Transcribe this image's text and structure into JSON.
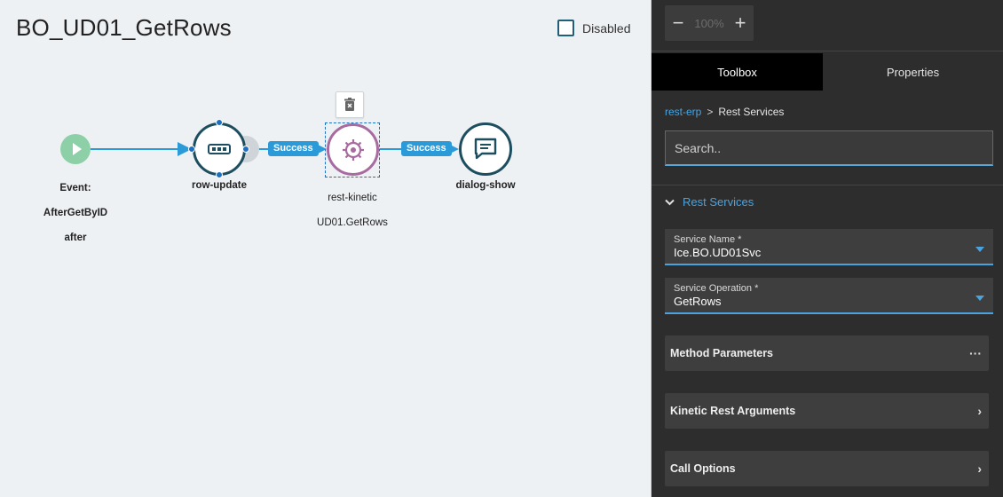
{
  "canvas": {
    "title": "BO_UD01_GetRows",
    "disabled_label": "Disabled",
    "nodes": {
      "start": {
        "label_line1": "Event:",
        "label_line2": "AfterGetByID",
        "label_line3": "after",
        "icon": "play-icon",
        "color": "#8dd0a7"
      },
      "row_update": {
        "label": "row-update",
        "icon": "row-update-icon",
        "color": "#1d4e5f"
      },
      "rest_kinetic": {
        "label_line1": "rest-kinetic",
        "label_line2": "UD01.GetRows",
        "icon": "gear-icon",
        "color": "#a86b9f"
      },
      "dialog_show": {
        "label": "dialog-show",
        "icon": "chat-icon",
        "color": "#1d4e5f"
      }
    },
    "edges": {
      "success_1": "Success",
      "success_2": "Success",
      "color": "#2b9ad8"
    },
    "delete_icon": "trash-icon"
  },
  "panel": {
    "zoom": {
      "minus": "−",
      "value": "100%",
      "plus": "+"
    },
    "tabs": [
      {
        "label": "Toolbox",
        "active": true
      },
      {
        "label": "Properties",
        "active": false
      }
    ],
    "breadcrumb": {
      "link": "rest-erp",
      "sep": ">",
      "current": "Rest Services"
    },
    "search_placeholder": "Search..",
    "section": {
      "title": "Rest Services",
      "icon": "chevron-down-icon"
    },
    "fields": {
      "service_name": {
        "label": "Service Name *",
        "value": "Ice.BO.UD01Svc"
      },
      "service_operation": {
        "label": "Service Operation *",
        "value": "GetRows"
      }
    },
    "rows": {
      "method_parameters": {
        "label": "Method Parameters",
        "icon": "···"
      },
      "kinetic_rest_arguments": {
        "label": "Kinetic Rest Arguments",
        "icon": "›"
      },
      "call_options": {
        "label": "Call Options",
        "icon": "›"
      }
    },
    "accent": "#4aa3df"
  }
}
